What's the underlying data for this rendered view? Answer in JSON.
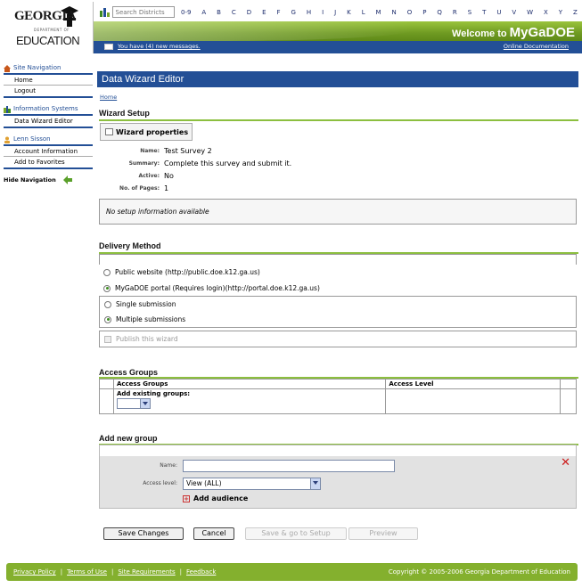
{
  "header": {
    "logo": {
      "line1": "GEORGIA",
      "line2": "DEPARTMENT OF",
      "line3": "EDUCATION"
    },
    "search_placeholder": "Search Districts",
    "alphabet": [
      "0-9",
      "A",
      "B",
      "C",
      "D",
      "E",
      "F",
      "G",
      "H",
      "I",
      "J",
      "K",
      "L",
      "M",
      "N",
      "O",
      "P",
      "Q",
      "R",
      "S",
      "T",
      "U",
      "V",
      "W",
      "X",
      "Y",
      "Z"
    ],
    "welcome_prefix": "Welcome to",
    "welcome_brand": "MyGaDOE",
    "messages_link": "You have (4) new messages.",
    "docs_link": "Online Documentation",
    "colors": {
      "green": "#7aa82a",
      "blue": "#234f96"
    }
  },
  "sidebar": {
    "site_nav": {
      "title": "Site Navigation",
      "icon": "home-icon",
      "items": [
        "Home",
        "Logout"
      ]
    },
    "info_systems": {
      "title": "Information Systems",
      "icon": "building-icon",
      "items": [
        "Data Wizard Editor"
      ]
    },
    "user": {
      "title": "Lenn Sisson",
      "icon": "user-icon",
      "items": [
        "Account Information",
        "Add to Favorites"
      ]
    },
    "hide_nav": "Hide Navigation"
  },
  "main": {
    "title": "Data Wizard Editor",
    "breadcrumb": "Home",
    "wizard_setup": {
      "heading": "Wizard Setup",
      "properties_button": "Wizard properties",
      "fields": [
        {
          "label": "Name:",
          "value": "Test Survey 2"
        },
        {
          "label": "Summary:",
          "value": "Complete this survey and submit it."
        },
        {
          "label": "Active:",
          "value": "No"
        },
        {
          "label": "No. of Pages:",
          "value": "1"
        }
      ],
      "no_setup": "No setup information available"
    },
    "delivery": {
      "heading": "Delivery Method",
      "public": "Public website (http://public.doe.k12.ga.us)",
      "portal": "MyGaDOE portal (Requires login)(http://portal.doe.k12.ga.us)",
      "single": "Single submission",
      "multiple": "Multiple submissions",
      "publish": "Publish this wizard",
      "selected_site": "portal",
      "selected_submission": "multiple"
    },
    "access_groups": {
      "heading": "Access Groups",
      "col1": "Access Groups",
      "col2": "Access Level",
      "add_existing": "Add existing groups:"
    },
    "new_group": {
      "heading": "Add new group",
      "name_label": "Name:",
      "access_label": "Access level:",
      "access_value": "View (ALL)",
      "add_audience": "Add audience"
    },
    "buttons": {
      "save": "Save Changes",
      "cancel": "Cancel",
      "save_setup": "Save & go to Setup",
      "preview": "Preview"
    }
  },
  "footer": {
    "links": [
      "Privacy Policy",
      "Terms of Use",
      "Site Requirements",
      "Feedback"
    ],
    "copyright": "Copyright © 2005-2006 Georgia Department of Education"
  }
}
